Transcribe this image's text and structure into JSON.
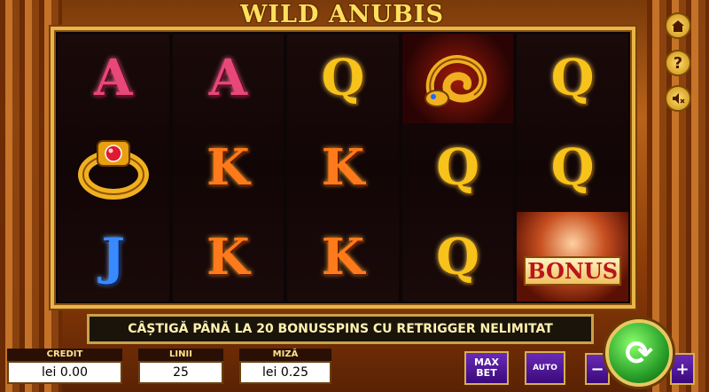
{
  "title": "WILD ANUBIS",
  "reels": [
    [
      "A",
      "ring",
      "J"
    ],
    [
      "A",
      "K",
      "K"
    ],
    [
      "Q",
      "K",
      "K"
    ],
    [
      "snake",
      "Q",
      "Q"
    ],
    [
      "Q",
      "Q",
      "BONUS"
    ]
  ],
  "symbol_icons": {
    "ring": "jeweled-ring-icon",
    "snake": "golden-snake-icon"
  },
  "message": "CÂȘTIGĂ PÂNĂ LA 20 BONUSSPINS CU RETRIGGER NELIMITAT",
  "credit": {
    "label": "CREDIT",
    "value": "lei 0.00"
  },
  "lines": {
    "label": "LINII",
    "value": "25"
  },
  "bet": {
    "label": "MIZĂ",
    "value": "lei 0.25"
  },
  "buttons": {
    "maxbet_line1": "MAX",
    "maxbet_line2": "BET",
    "auto": "AUTO",
    "minus": "−",
    "plus": "+",
    "spin": "⟳"
  },
  "side": {
    "home_icon": "home-icon",
    "help": "?",
    "sound_icon": "sound-off-icon"
  },
  "colors": {
    "frame": "#e8b648",
    "spin": "#2aa02a",
    "button": "#4a1a90"
  }
}
